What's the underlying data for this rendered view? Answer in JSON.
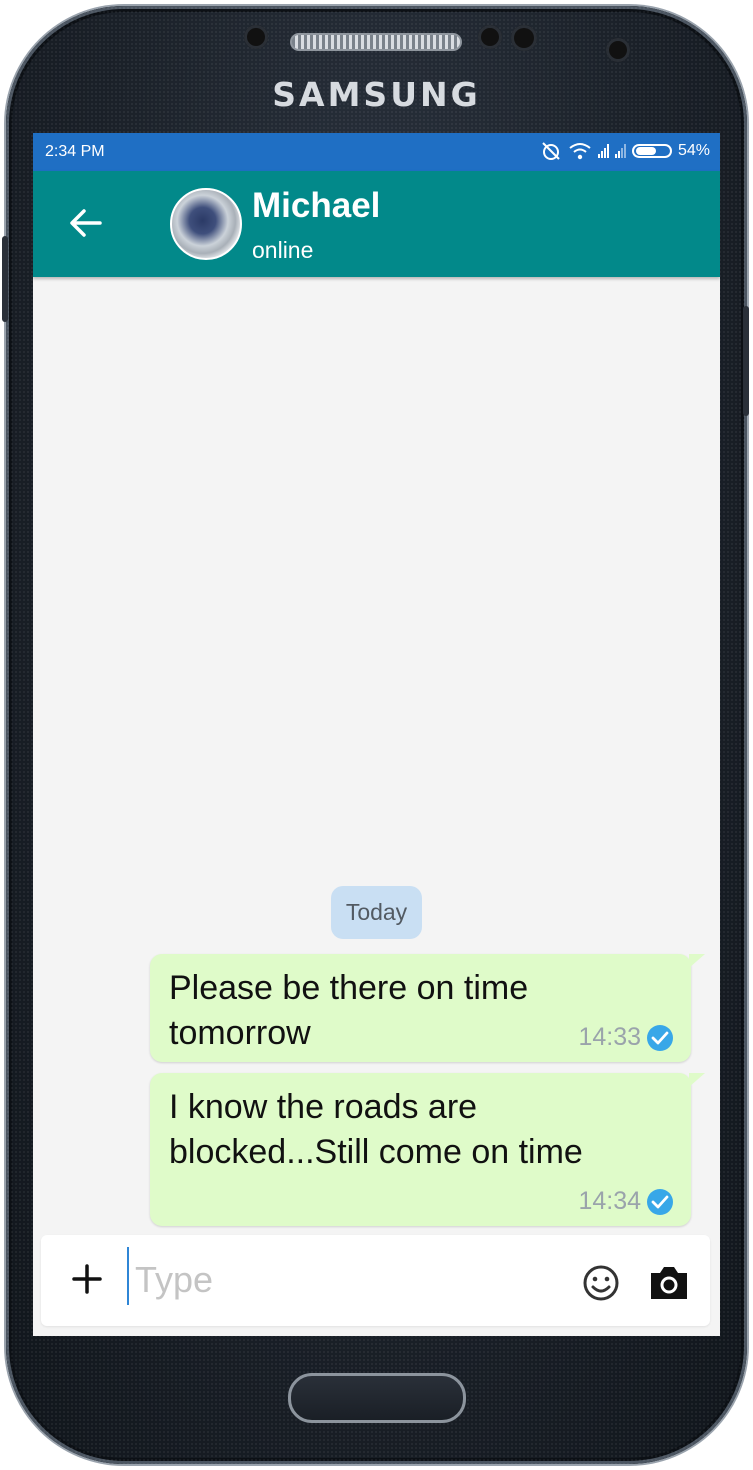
{
  "device": {
    "brand": "SAMSUNG"
  },
  "status_bar": {
    "time": "2:34 PM",
    "battery": "54%"
  },
  "header": {
    "contact_name": "Michael",
    "contact_status": "online"
  },
  "chat": {
    "date_separator": "Today",
    "messages": [
      {
        "text": "Please be there on time tomorrow",
        "time": "14:33",
        "status_icon": "read-check-icon"
      },
      {
        "text": "I know the roads are blocked...Still come on time",
        "time": "14:34",
        "status_icon": "read-check-icon"
      }
    ]
  },
  "composer": {
    "placeholder": "Type"
  },
  "colors": {
    "status_bar": "#1f6fc4",
    "app_bar": "#02898a",
    "bubble": "#dffbc9",
    "date_chip": "#c9dff3",
    "check": "#38a7e8",
    "chat_bg": "#f4f4f4"
  }
}
